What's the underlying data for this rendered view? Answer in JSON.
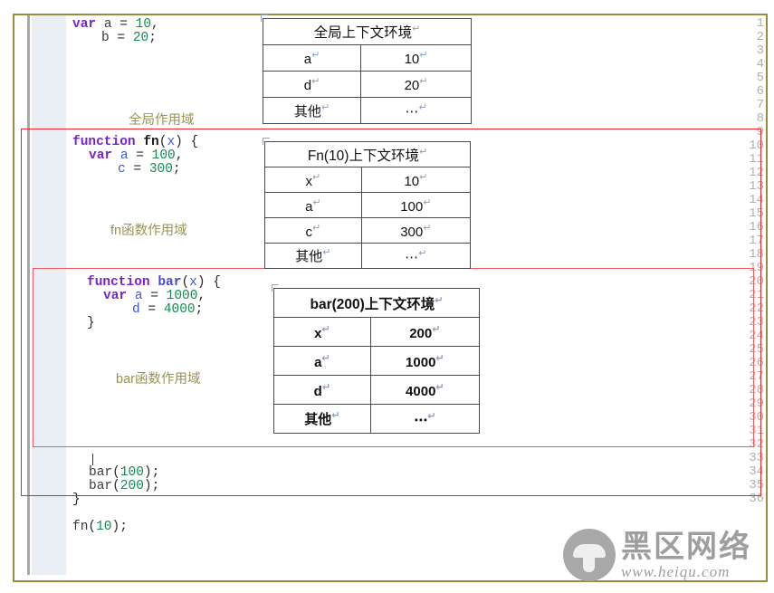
{
  "editor": {
    "line_numbers": [
      1,
      2,
      3,
      4,
      5,
      6,
      7,
      8,
      9,
      10,
      11,
      12,
      13,
      14,
      15,
      16,
      17,
      18,
      19,
      20,
      21,
      22,
      23,
      24,
      25,
      26,
      27,
      28,
      29,
      30,
      31,
      32,
      33,
      34,
      35,
      36
    ],
    "code_lines": [
      {
        "line": 1,
        "text": "var a = 10,"
      },
      {
        "line": 2,
        "text": "    b = 20;"
      },
      {
        "line": 9,
        "text": "function fn(x) {"
      },
      {
        "line": 10,
        "text": "  var a = 100,"
      },
      {
        "line": 11,
        "text": "      c = 300;"
      },
      {
        "line": 19,
        "text": "  function bar(x) {"
      },
      {
        "line": 20,
        "text": "    var a = 1000,"
      },
      {
        "line": 21,
        "text": "        d = 4000;"
      },
      {
        "line": 22,
        "text": "  }"
      },
      {
        "line": 32,
        "text": "  bar(100);"
      },
      {
        "line": 33,
        "text": "  bar(200);"
      },
      {
        "line": 34,
        "text": "}"
      },
      {
        "line": 36,
        "text": "fn(10);"
      }
    ],
    "tokens": {
      "kw_var": "var",
      "kw_function": "function",
      "name_fn": "fn",
      "name_bar": "bar",
      "param_x": "x",
      "var_a": "a",
      "var_b": "b",
      "var_c": "c",
      "var_d": "d",
      "num_10": "10",
      "num_20": "20",
      "num_100": "100",
      "num_300": "300",
      "num_1000": "1000",
      "num_4000": "4000",
      "num_200": "200",
      "punct_eq": "=",
      "punct_comma": ",",
      "punct_semi": ";",
      "punct_lparen": "(",
      "punct_rparen": ")",
      "punct_lbrace": "{",
      "punct_rbrace": "}"
    }
  },
  "scope_labels": {
    "global": "全局作用域",
    "fn": "fn函数作用域",
    "bar": "bar函数作用域"
  },
  "tables": {
    "global": {
      "header": "全局上下文环境",
      "rows": [
        {
          "key": "a",
          "value": "10"
        },
        {
          "key": "d",
          "value": "20"
        },
        {
          "key": "其他",
          "value": "⋯"
        }
      ]
    },
    "fn": {
      "header": "Fn(10)上下文环境",
      "rows": [
        {
          "key": "x",
          "value": "10"
        },
        {
          "key": "a",
          "value": "100"
        },
        {
          "key": "c",
          "value": "300"
        },
        {
          "key": "其他",
          "value": "⋯"
        }
      ]
    },
    "bar": {
      "header": "bar(200)上下文环境",
      "rows": [
        {
          "key": "x",
          "value": "200"
        },
        {
          "key": "a",
          "value": "1000"
        },
        {
          "key": "d",
          "value": "4000"
        },
        {
          "key": "其他",
          "value": "⋯"
        }
      ]
    },
    "pilcrow": "↵"
  },
  "watermark": {
    "brand": "黑区网络",
    "url": "www.heiqu.com",
    "logo_icon": "mushroom-icon"
  },
  "colors": {
    "frame_border": "#958c3d",
    "redbox_outer": "#e8222a",
    "redbox_inner": "#f1595e",
    "keyword": "#7b23c7",
    "number": "#128a52",
    "param": "#3b57d6",
    "scope_label": "#9a9250",
    "gutter_bg": "#eaeff5",
    "linenum": "#b0b0b0",
    "watermark": "#9e9e9e"
  }
}
